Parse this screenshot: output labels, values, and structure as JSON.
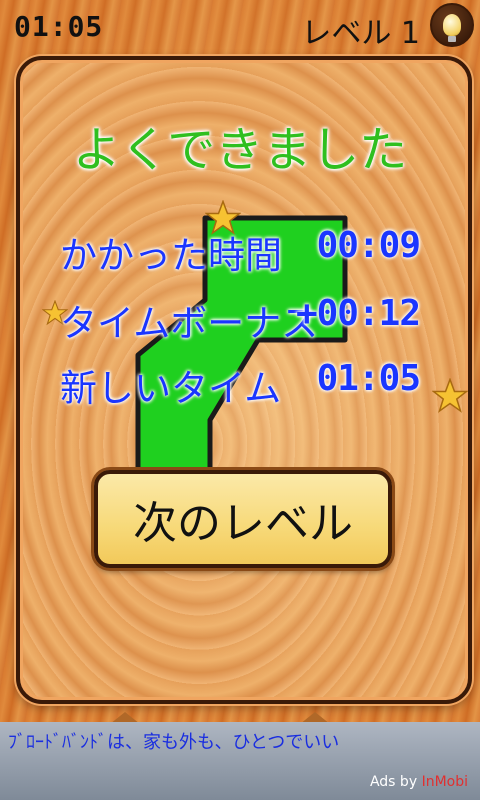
{
  "header": {
    "timer": "01:05",
    "level_label": "レベル 1"
  },
  "result": {
    "title": "よくできました",
    "rows": [
      {
        "label": "かかった時間",
        "value": "00:09"
      },
      {
        "label": "タイムボーナス",
        "value": "+00:12"
      },
      {
        "label": "新しいタイム",
        "value": "01:05"
      }
    ],
    "next_button_label": "次のレベル"
  },
  "ad": {
    "text": "ﾌﾞﾛｰﾄﾞﾊﾞﾝﾄﾞは、家も外も、ひとつでいい",
    "credit_prefix": "Ads by",
    "credit_brand": "InMobi"
  },
  "colors": {
    "title": "#2fbf1f",
    "stats": "#1a36ff",
    "piece": "#1fd01f",
    "button": "#f7d978"
  },
  "icons": {
    "hint": "lightbulb-icon",
    "star": "star-icon"
  }
}
